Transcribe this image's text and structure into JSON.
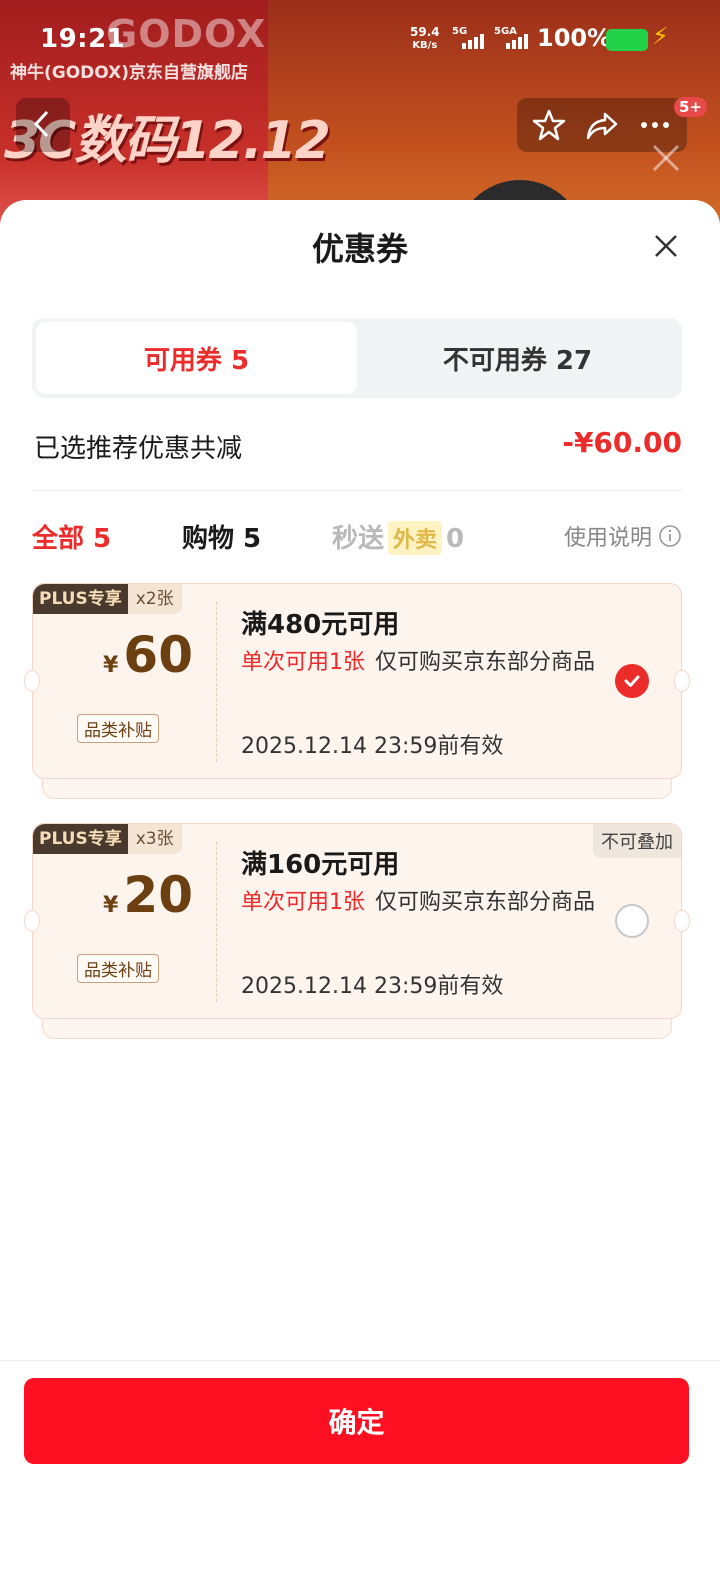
{
  "status_bar": {
    "time": "19:21",
    "net_speed_value": "59.4",
    "net_speed_unit": "KB/s",
    "sim1": "5G",
    "sim2": "5GA",
    "battery": "100%"
  },
  "background": {
    "logo": "GODOX",
    "store_name": "神牛(GODOX)京东自营旗舰店",
    "promo": "3C数码12.12",
    "notification_count": "5+"
  },
  "sheet": {
    "title": "优惠券",
    "tabs": [
      {
        "label": "可用券 5",
        "active": true
      },
      {
        "label": "不可用券 27",
        "active": false
      }
    ],
    "summary_label": "已选推荐优惠共减",
    "summary_amount": "-¥60.00",
    "filters": {
      "all": "全部 5",
      "shopping": "购物 5",
      "fast_prefix": "秒送",
      "fast_tag": "外卖",
      "fast_count": "0",
      "usage_help": "使用说明"
    }
  },
  "coupons": [
    {
      "plus_label": "PLUS专享",
      "count": "x2张",
      "currency": "¥",
      "amount": "60",
      "category": "品类补贴",
      "title": "满480元可用",
      "limit": "单次可用1张",
      "scope": "仅可购买京东部分商品",
      "expiry": "2025.12.14 23:59前有效",
      "selected": true
    },
    {
      "plus_label": "PLUS专享",
      "count": "x3张",
      "currency": "¥",
      "amount": "20",
      "category": "品类补贴",
      "title": "满160元可用",
      "limit": "单次可用1张",
      "scope": "仅可购买京东部分商品",
      "expiry": "2025.12.14 23:59前有效",
      "stack_note": "不可叠加",
      "selected": false
    }
  ],
  "confirm_label": "确定",
  "colors": {
    "accent_red": "#ec2b2b",
    "button_red": "#fe0f22",
    "coupon_bg": "#fdf4ee",
    "price_brown": "#6b3f10"
  }
}
